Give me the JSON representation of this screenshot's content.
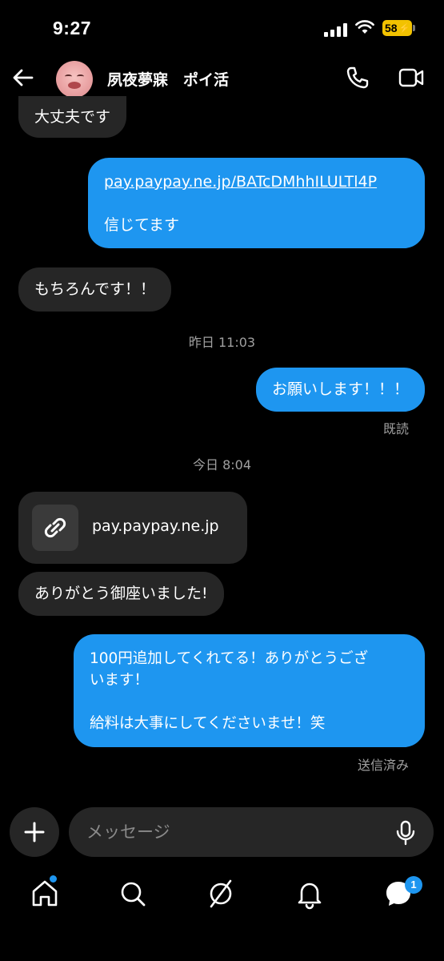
{
  "status_bar": {
    "time": "9:27",
    "battery": "58"
  },
  "header": {
    "contact_name": "夙夜夢寐　ポイ活"
  },
  "messages": [
    {
      "side": "incoming",
      "text": "大丈夫です"
    },
    {
      "side": "outgoing",
      "link": "pay.paypay.ne.jp/BATcDMhhILULTl4P",
      "text": "信じてます"
    },
    {
      "side": "incoming",
      "text": "もちろんです！！"
    },
    {
      "side": "outgoing",
      "text": "お願いします！！！"
    },
    {
      "side": "incoming",
      "text": "ありがとう御座いました!"
    },
    {
      "side": "outgoing",
      "line1": "100円追加してくれてる！ありがとうござ",
      "line2": "います！",
      "line3": "給料は大事にしてくださいませ！笑"
    }
  ],
  "timestamps": {
    "yesterday": "昨日 11:03",
    "today": "今日 8:04"
  },
  "receipts": {
    "read": "既読",
    "sent": "送信済み"
  },
  "link_card": {
    "domain": "pay.paypay.ne.jp"
  },
  "composer": {
    "placeholder": "メッセージ"
  },
  "nav": {
    "messages_badge": "1"
  },
  "colors": {
    "outgoing_bubble": "#1e96f0",
    "incoming_bubble": "#262626",
    "battery": "#f2c200"
  }
}
